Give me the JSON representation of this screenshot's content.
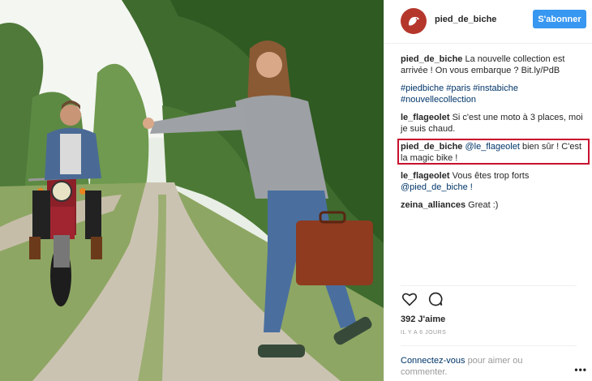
{
  "post": {
    "username": "pied_de_biche",
    "follow_label": "S'abonner",
    "caption_user": "pied_de_biche",
    "caption_text": "La nouvelle collection est arrivée ! On vous embarque ? Bit.ly/PdB",
    "hashtags": "#piedbiche #paris #instabiche #nouvellecollection",
    "comments": [
      {
        "user": "le_flageolet",
        "text": "Si c'est une moto à 3 places, moi je suis chaud."
      },
      {
        "user": "pied_de_biche",
        "mention": "@le_flageolet",
        "text": "bien sûr ! C'est la magic bike !"
      },
      {
        "user": "le_flageolet",
        "text": "Vous êtes trop forts",
        "mention": "@pied_de_biche !"
      },
      {
        "user": "zeina_alliances",
        "text": "Great :)"
      }
    ],
    "likes": "392 J'aime",
    "time": "IL Y A 6 JOURS",
    "login_link": "Connectez-vous",
    "login_text": "pour aimer ou commenter.",
    "more": "•••"
  },
  "colors": {
    "accent": "#3897f0",
    "highlight": "#c8102e",
    "avatar": "#b5372c"
  },
  "icons": {
    "avatar": "bird-logo-icon",
    "like": "heart-icon",
    "comment": "comment-bubble-icon",
    "more": "more-options-icon"
  }
}
